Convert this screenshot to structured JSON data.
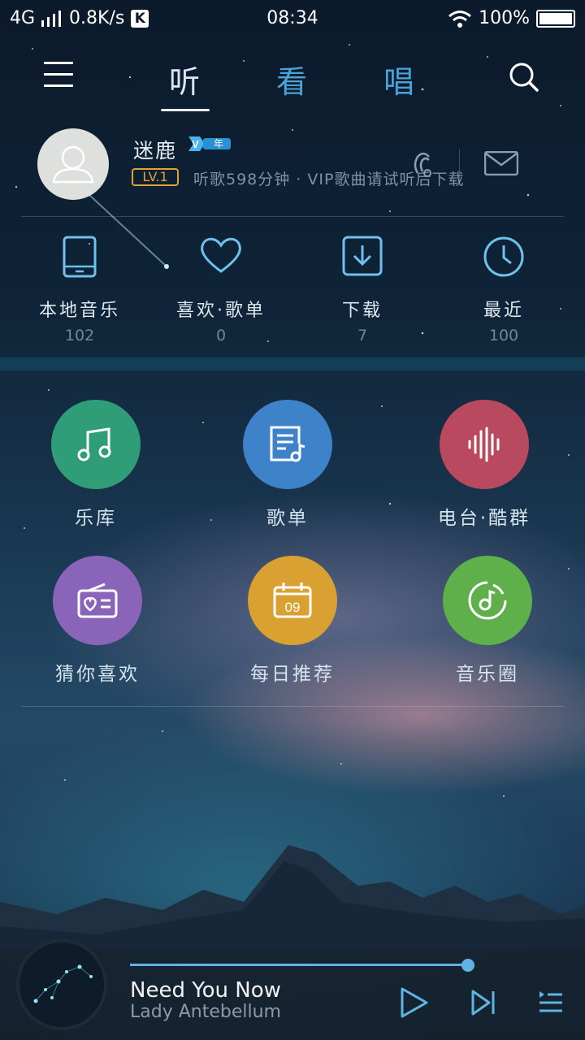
{
  "status_bar": {
    "network": "4G",
    "speed": "0.8K/s",
    "app_badge": "K",
    "time": "08:34",
    "battery": "100%"
  },
  "nav": {
    "tabs": [
      "听",
      "看",
      "唱"
    ],
    "active_tab": "听"
  },
  "profile": {
    "name": "迷鹿",
    "vip_badge_text": "V",
    "vip_badge_sub": "年",
    "level": "LV.1",
    "subtitle": "听歌598分钟 · VIP歌曲请试听后下载"
  },
  "quick": [
    {
      "label": "本地音乐",
      "count": "102",
      "icon": "tablet-icon"
    },
    {
      "label": "喜欢·歌单",
      "count": "0",
      "icon": "heart-icon"
    },
    {
      "label": "下载",
      "count": "7",
      "icon": "download-icon"
    },
    {
      "label": "最近",
      "count": "100",
      "icon": "clock-icon"
    }
  ],
  "grid": [
    {
      "label": "乐库",
      "color": "#2f9e78",
      "icon": "music-note-icon"
    },
    {
      "label": "歌单",
      "color": "#3e82c9",
      "icon": "playlist-icon"
    },
    {
      "label": "电台·酷群",
      "color": "#b8495e",
      "icon": "soundwave-icon"
    },
    {
      "label": "猜你喜欢",
      "color": "#8a64b8",
      "icon": "radio-icon"
    },
    {
      "label": "每日推荐",
      "color": "#d9a131",
      "icon": "calendar-icon",
      "calendar_day": "09"
    },
    {
      "label": "音乐圈",
      "color": "#5fb04a",
      "icon": "music-circle-icon"
    }
  ],
  "player": {
    "song": "Need You Now",
    "artist": "Lady Antebellum",
    "progress": 0.92
  },
  "colors": {
    "accent": "#5fb4e4",
    "level_badge": "#e0a13a"
  }
}
